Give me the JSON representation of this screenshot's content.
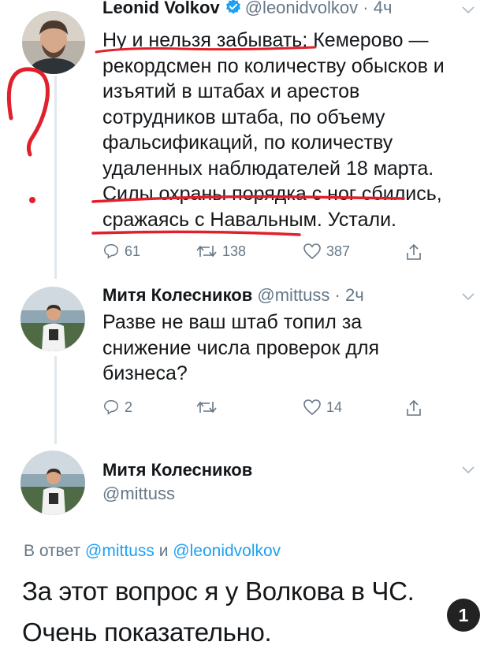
{
  "tweet1": {
    "name": "Leonid Volkov",
    "handle": "@leonidvolkov",
    "time": "4ч",
    "lines": [
      "Ну и нельзя забывать: Кемерово —",
      "рекордсмен по количеству обысков и",
      "изъятий в штабах и арестов",
      "сотрудников штаба, по объему",
      "фальсификаций, по количеству",
      "удаленных наблюдателей 18 марта.",
      "Силы охраны порядка с ног сбились,",
      "сражаясь с Навальным. Устали."
    ],
    "replies": "61",
    "retweets": "138",
    "likes": "387"
  },
  "tweet2": {
    "name": "Митя Колесников",
    "handle": "@mittuss",
    "time": "2ч",
    "lines": [
      "Разве не ваш штаб топил за",
      "снижение числа проверок для",
      "бизнеса?"
    ],
    "replies": "2",
    "retweets": "",
    "likes": "14"
  },
  "tweet3": {
    "name": "Митя Колесников",
    "handle": "@mittuss",
    "reply_prefix": "В ответ",
    "reply_mention_1": "@mittuss",
    "reply_conj": "и",
    "reply_mention_2": "@leonidvolkov",
    "lines": [
      "За этот вопрос я у Волкова в ЧС.",
      "Очень показательно."
    ]
  },
  "badge": "1",
  "colors": {
    "text": "#14171a",
    "secondary": "#657786",
    "link": "#1da1f2",
    "verified": "#1da1f2",
    "annotation": "#e0202a"
  },
  "icons": [
    "verified-icon",
    "chevron-down-icon",
    "reply-icon",
    "retweet-icon",
    "like-icon",
    "share-icon"
  ]
}
